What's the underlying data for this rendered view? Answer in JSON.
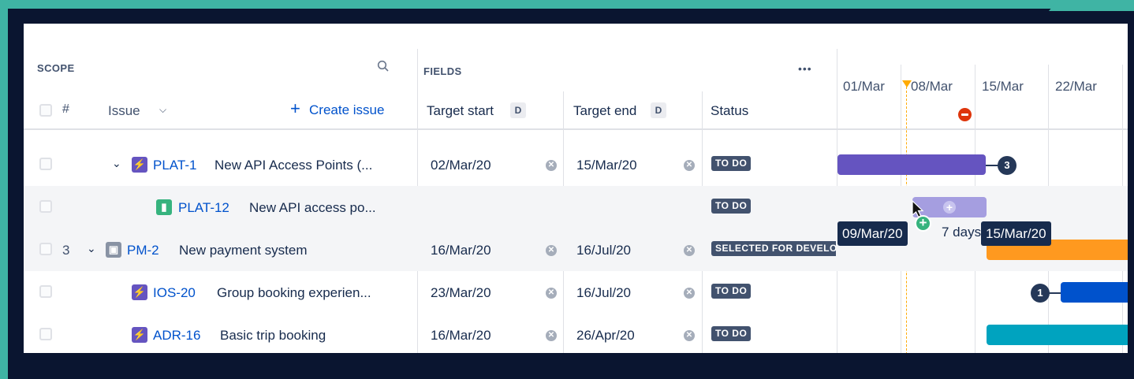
{
  "scope": {
    "title": "SCOPE",
    "hash": "#",
    "issue_header": "Issue",
    "create_issue": "Create issue"
  },
  "fields": {
    "title": "FIELDS",
    "more": "•••",
    "columns": [
      {
        "label": "Target start",
        "badge": "D"
      },
      {
        "label": "Target end",
        "badge": "D"
      },
      {
        "label": "Status"
      }
    ]
  },
  "timeline": {
    "dates": [
      "01/Mar",
      "08/Mar",
      "15/Mar",
      "22/Mar"
    ],
    "drag": {
      "start_tip": "09/Mar/20",
      "duration": "7 days",
      "end_tip": "15/Mar/20"
    }
  },
  "rows": [
    {
      "num": "",
      "key": "PLAT-1",
      "title": "New API Access Points (...",
      "start": "02/Mar/20",
      "end": "15/Mar/20",
      "status": "TO DO",
      "type": "epic",
      "badge": "3"
    },
    {
      "num": "",
      "key": "PLAT-12",
      "title": "New API access po...",
      "start": "",
      "end": "",
      "status": "TO DO",
      "type": "story"
    },
    {
      "num": "3",
      "key": "PM-2",
      "title": "New payment system",
      "start": "16/Mar/20",
      "end": "16/Jul/20",
      "status": "SELECTED FOR DEVELOPMENT",
      "type": "initiative"
    },
    {
      "num": "",
      "key": "IOS-20",
      "title": "Group booking experien...",
      "start": "23/Mar/20",
      "end": "16/Jul/20",
      "status": "TO DO",
      "type": "epic",
      "badge": "1"
    },
    {
      "num": "",
      "key": "ADR-16",
      "title": "Basic trip booking",
      "start": "16/Mar/20",
      "end": "26/Apr/20",
      "status": "TO DO",
      "type": "epic"
    }
  ],
  "colors": {
    "epic": "#6554c0",
    "story": "#36b37e",
    "initiative": "#8993a4",
    "bar_purple": "#6554c0",
    "bar_light_purple": "#a59ee0",
    "bar_orange": "#ff991f",
    "bar_blue": "#0052cc",
    "bar_teal": "#00a3bf",
    "today_marker": "#ffab00",
    "remove_red": "#de350b",
    "add_green": "#36b37e"
  }
}
